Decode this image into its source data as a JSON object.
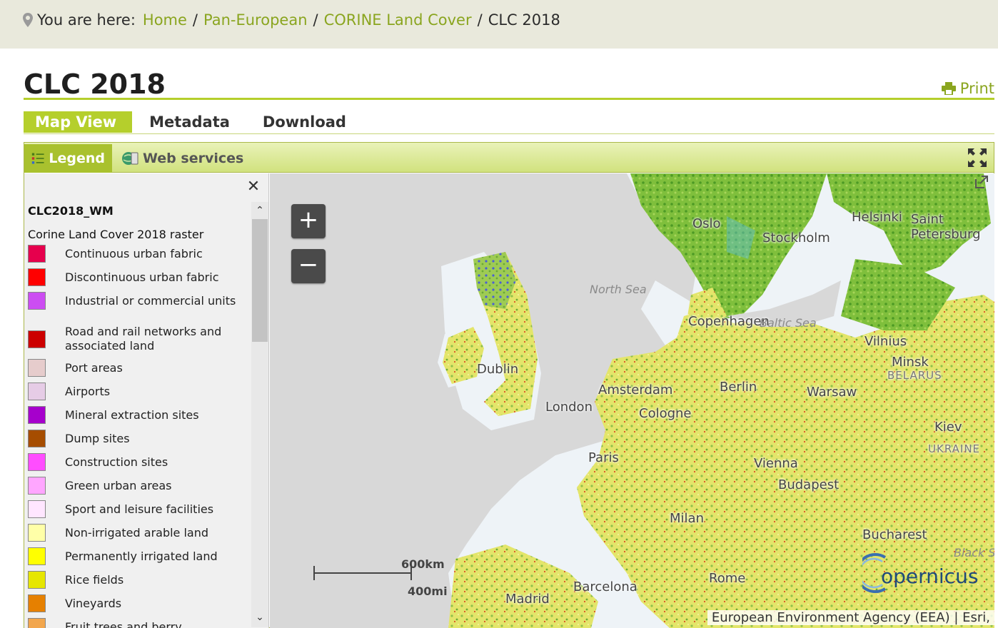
{
  "breadcrumb": {
    "prefix": "You are here:",
    "items": [
      "Home",
      "Pan-European",
      "CORINE Land Cover"
    ],
    "current": "CLC 2018",
    "separator": "/"
  },
  "page": {
    "title": "CLC 2018",
    "print_label": "Print"
  },
  "tabs": [
    "Map View",
    "Metadata",
    "Download"
  ],
  "viewer": {
    "tabs": [
      "Legend",
      "Web services"
    ],
    "legend": {
      "layer_name": "CLC2018_WM",
      "subtitle": "Corine Land Cover 2018 raster",
      "items": [
        {
          "label": "Continuous urban fabric",
          "color": "#e6004d"
        },
        {
          "label": "Discontinuous urban fabric",
          "color": "#ff0000"
        },
        {
          "label": "Industrial or commercial units",
          "color": "#cc4df2"
        },
        {
          "label": "Road and rail networks and associated land",
          "color": "#cc0000"
        },
        {
          "label": "Port areas",
          "color": "#e6cccc"
        },
        {
          "label": "Airports",
          "color": "#e6cce6"
        },
        {
          "label": "Mineral extraction sites",
          "color": "#a600cc"
        },
        {
          "label": "Dump sites",
          "color": "#a64d00"
        },
        {
          "label": "Construction sites",
          "color": "#ff4dff"
        },
        {
          "label": "Green urban areas",
          "color": "#ffa6ff"
        },
        {
          "label": "Sport and leisure facilities",
          "color": "#ffe6ff"
        },
        {
          "label": "Non-irrigated arable land",
          "color": "#ffffa8"
        },
        {
          "label": "Permanently irrigated land",
          "color": "#ffff00"
        },
        {
          "label": "Rice fields",
          "color": "#e6e600"
        },
        {
          "label": "Vineyards",
          "color": "#e68000"
        },
        {
          "label": "Fruit trees and berry",
          "color": "#f2a64d"
        }
      ]
    },
    "map": {
      "zoom_in": "+",
      "zoom_out": "−",
      "cities": [
        "Oslo",
        "Stockholm",
        "Helsinki",
        "Saint Petersburg",
        "Copenhagen",
        "Vilnius",
        "Minsk",
        "Dublin",
        "Amsterdam",
        "Berlin",
        "Warsaw",
        "London",
        "Cologne",
        "Kiev",
        "Paris",
        "Vienna",
        "Budapest",
        "Milan",
        "Bucharest",
        "Barcelona",
        "Rome",
        "Madrid"
      ],
      "countries": [
        "BELARUS",
        "UKRAINE"
      ],
      "seas": [
        "North Sea",
        "Baltic Sea",
        "Black Sea"
      ],
      "scale_km": "600km",
      "scale_mi": "400mi",
      "attribution": "European Environment Agency (EEA) | Esri,",
      "logo_text": "opernicus",
      "colors": {
        "land_green": "#a4d05a",
        "forest": "#5ba12c",
        "arable": "#ece86a",
        "urban": "#e60000",
        "water_bg": "#d8d8d8",
        "coast": "#eef3f7"
      }
    }
  }
}
